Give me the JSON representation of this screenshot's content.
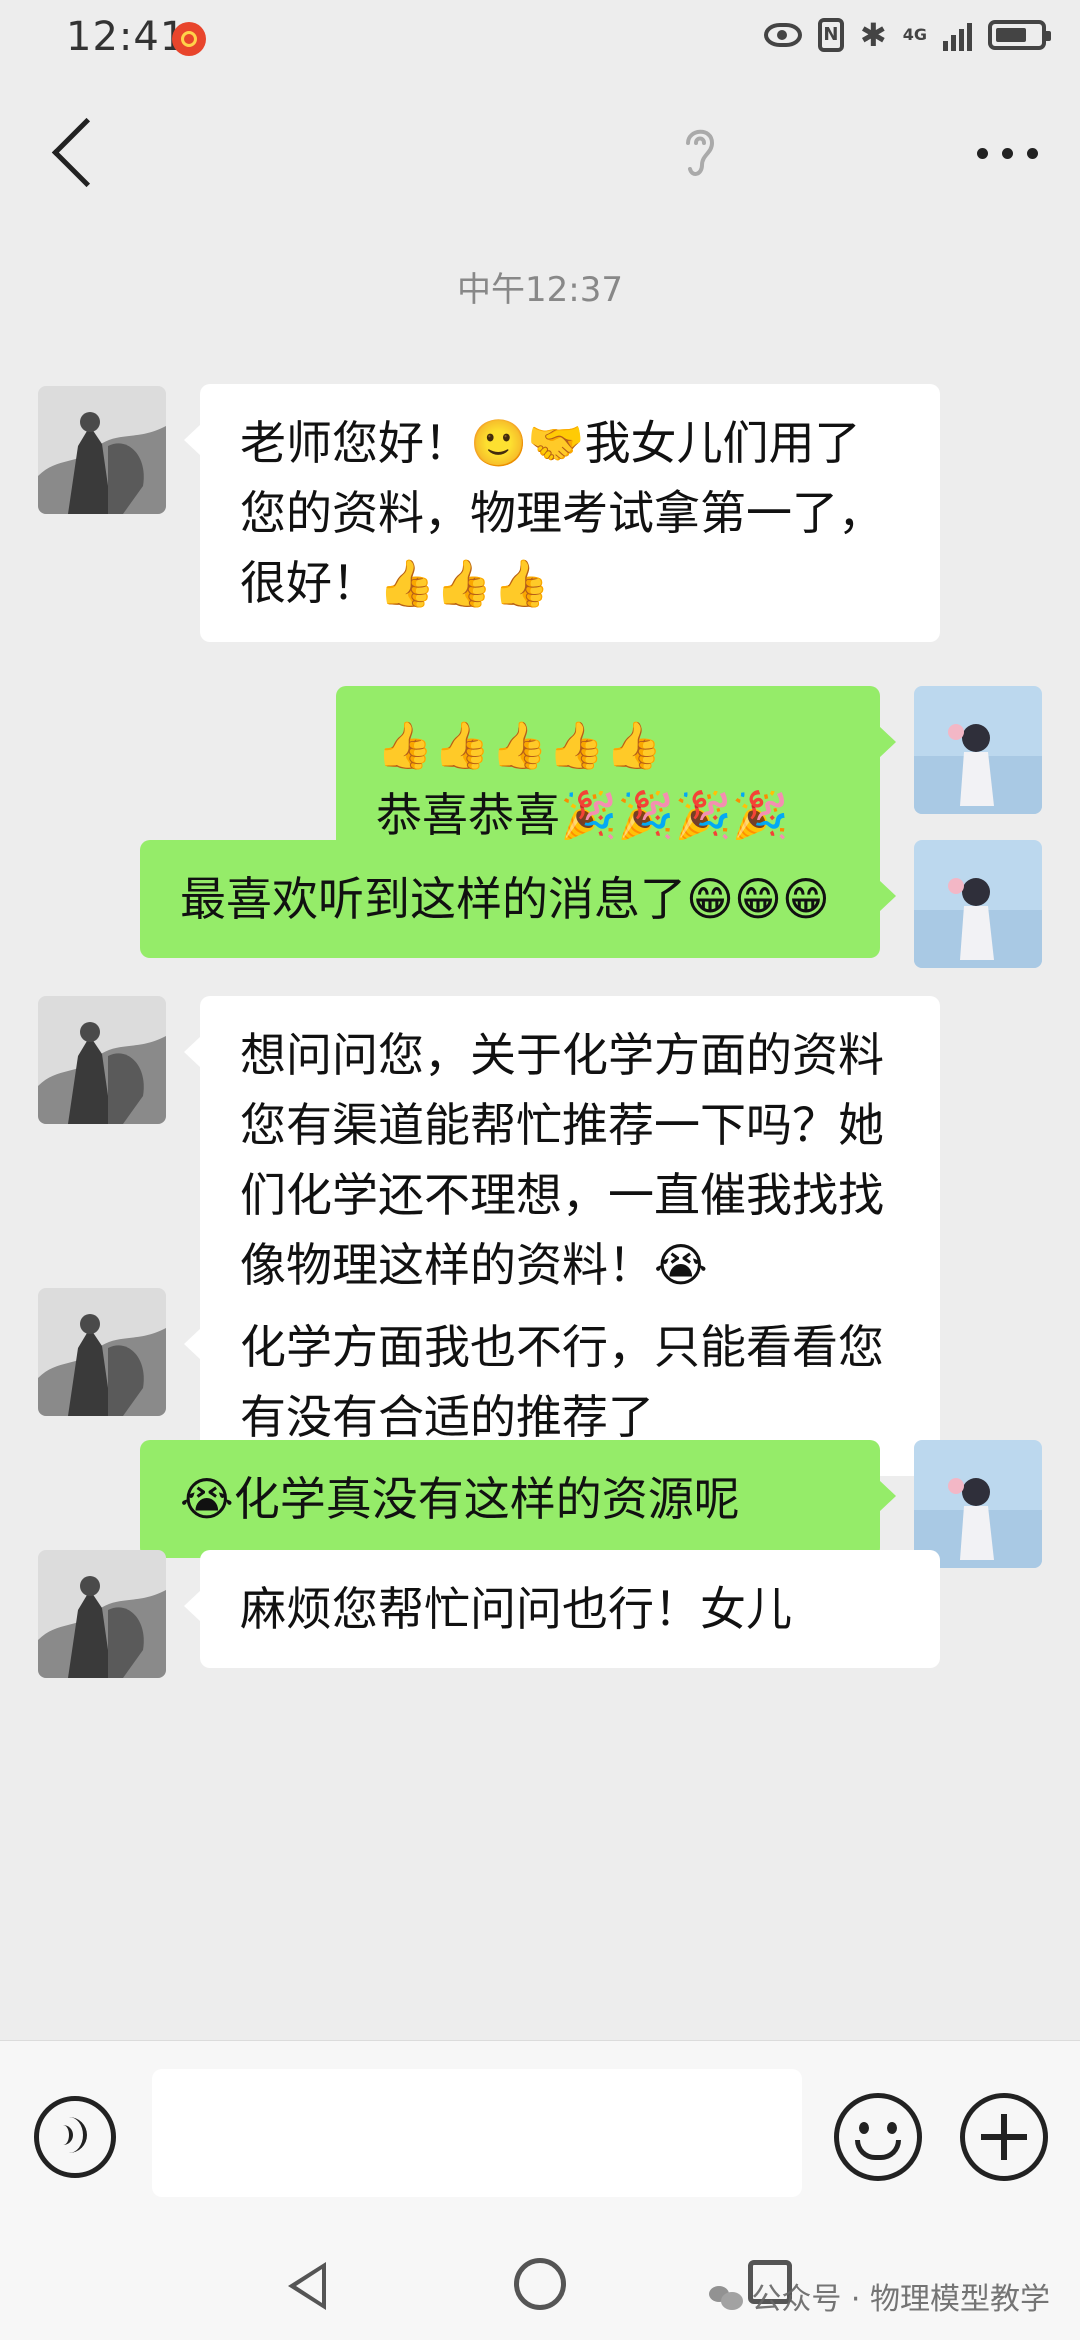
{
  "status_bar": {
    "time": "12:41",
    "network": "4G"
  },
  "chat": {
    "timestamp": "中午12:37",
    "messages": [
      {
        "from": "teacher",
        "text": "老师您好！🙂🤝我女儿们用了您的资料，物理考试拿第一了，很好！👍👍👍"
      },
      {
        "from": "me",
        "text": "👍👍👍👍👍\n恭喜恭喜🎉🎉🎉🎉"
      },
      {
        "from": "me",
        "text": "最喜欢听到这样的消息了😁😁😁"
      },
      {
        "from": "teacher",
        "text": "想问问您，关于化学方面的资料您有渠道能帮忙推荐一下吗？她们化学还不理想，一直催我找找像物理这样的资料！😭"
      },
      {
        "from": "teacher",
        "text": "化学方面我也不行，只能看看您有没有合适的推荐了"
      },
      {
        "from": "me",
        "text": "😭化学真没有这样的资源呢"
      },
      {
        "from": "teacher",
        "text": "麻烦您帮忙问问也行！女儿"
      }
    ]
  },
  "input": {
    "value": ""
  },
  "watermark": {
    "text": "公众号 · 物理模型教学"
  },
  "colors": {
    "background": "#ededed",
    "bubble_out": "#95ec69",
    "bubble_in": "#ffffff"
  }
}
